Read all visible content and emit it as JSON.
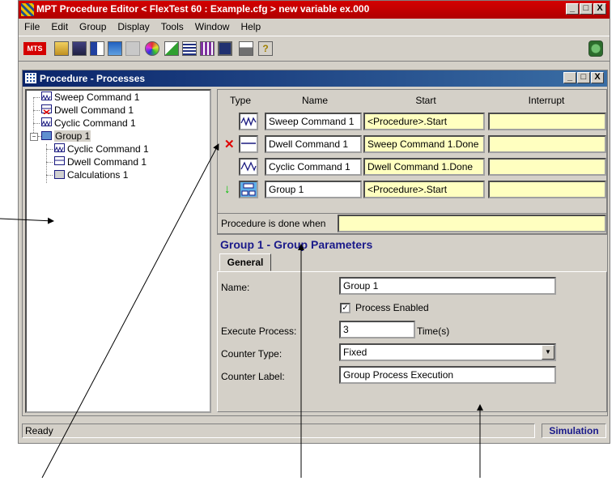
{
  "window": {
    "title": "MPT Procedure Editor  < FlexTest 60 : Example.cfg >  new variable ex.000",
    "minimize": "_",
    "maximize": "□",
    "close": "X"
  },
  "menu": [
    "File",
    "Edit",
    "Group",
    "Display",
    "Tools",
    "Window",
    "Help"
  ],
  "toolbar": {
    "logo_text": "MTS",
    "icons": [
      "open-icon",
      "save-icon",
      "add-process-icon",
      "group-icon",
      "ungroup-icon",
      "color-icon",
      "edit-icon",
      "properties-icon",
      "stats-icon",
      "monitor-icon",
      "lock-icon",
      "help-icon",
      "recycle-bin-icon"
    ]
  },
  "child_window": {
    "title": "Procedure - Processes",
    "minimize": "_",
    "maximize": "□",
    "close": "X"
  },
  "tree": {
    "items": [
      {
        "label": "Sweep Command 1",
        "icon": "sweep-icon"
      },
      {
        "label": "Dwell Command 1",
        "icon": "dwell-icon"
      },
      {
        "label": "Cyclic Command 1",
        "icon": "cyclic-icon"
      },
      {
        "label": "Group 1",
        "icon": "group-icon",
        "expander": "−"
      },
      {
        "label": "Cyclic Command 1",
        "icon": "cyclic-icon"
      },
      {
        "label": "Dwell Command 1",
        "icon": "dwell-icon"
      },
      {
        "label": "Calculations 1",
        "icon": "calculator-icon"
      }
    ]
  },
  "process_table": {
    "headers": {
      "type": "Type",
      "name": "Name",
      "start": "Start",
      "interrupt": "Interrupt"
    },
    "rows": [
      {
        "mark": "",
        "icon": "sweep-icon",
        "name": "Sweep Command 1",
        "start": "<Procedure>.Start",
        "interrupt": ""
      },
      {
        "mark": "✕",
        "icon": "dwell-icon",
        "name": "Dwell Command 1",
        "start": "Sweep Command 1.Done",
        "interrupt": ""
      },
      {
        "mark": "",
        "icon": "cyclic-icon",
        "name": "Cyclic Command 1",
        "start": "Dwell Command 1.Done",
        "interrupt": ""
      },
      {
        "mark": "↓",
        "icon": "group-icon",
        "name": "Group 1",
        "start": "<Procedure>.Start",
        "interrupt": ""
      }
    ],
    "mark_colors": {
      "x": "#e00000",
      "arrow": "#00c000"
    }
  },
  "procedure_done": {
    "label": "Procedure is done when",
    "value": ""
  },
  "group_params": {
    "title": "Group 1 - Group Parameters",
    "tab": "General",
    "name_label": "Name:",
    "name_value": "Group 1",
    "enabled_label": "Process Enabled",
    "enabled_checked": "✓",
    "execute_label": "Execute Process:",
    "execute_value": "3",
    "execute_unit": "Time(s)",
    "counter_type_label": "Counter Type:",
    "counter_type_value": "Fixed",
    "counter_label_label": "Counter Label:",
    "counter_label_value": "Group Process Execution"
  },
  "status": {
    "left": "Ready",
    "right": "Simulation"
  },
  "colors": {
    "title_bar": "#c80000",
    "child_title": "#0a246a",
    "highlight_field": "#ffffc0",
    "group_title": "#1a1a8a"
  }
}
